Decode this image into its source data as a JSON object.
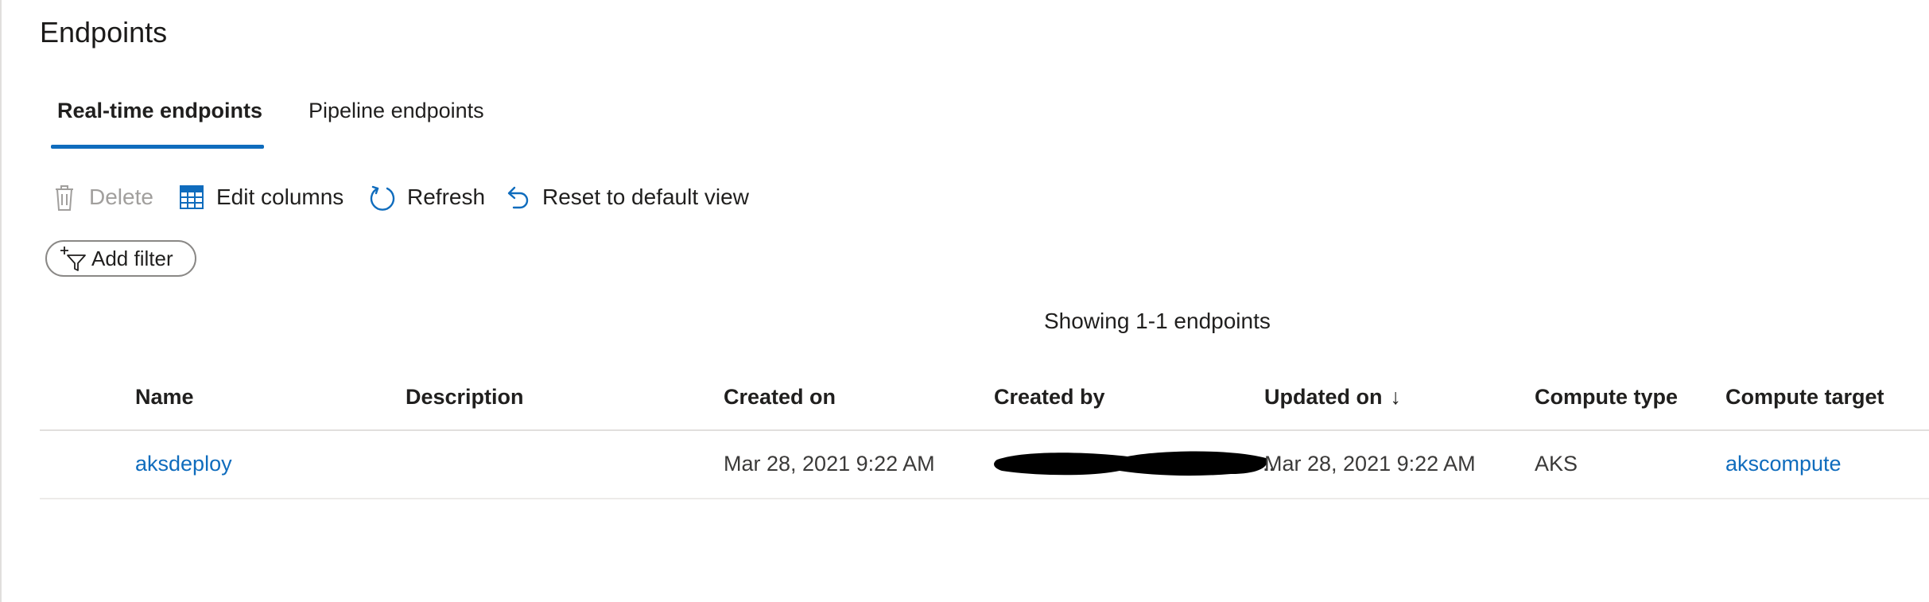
{
  "page": {
    "title": "Endpoints"
  },
  "tabs": [
    {
      "label": "Real-time endpoints",
      "active": true
    },
    {
      "label": "Pipeline endpoints",
      "active": false
    }
  ],
  "toolbar": {
    "delete_label": "Delete",
    "edit_columns_label": "Edit columns",
    "refresh_label": "Refresh",
    "reset_label": "Reset to default view"
  },
  "filter": {
    "add_filter_label": "Add filter"
  },
  "results": {
    "showing_text": "Showing 1-1 endpoints"
  },
  "table": {
    "columns": [
      {
        "label": "Name"
      },
      {
        "label": "Description"
      },
      {
        "label": "Created on"
      },
      {
        "label": "Created by"
      },
      {
        "label": "Updated on",
        "sort": "descending"
      },
      {
        "label": "Compute type"
      },
      {
        "label": "Compute target"
      }
    ],
    "rows": [
      {
        "name": "aksdeploy",
        "description": "",
        "created_on": "Mar 28, 2021 9:22 AM",
        "created_by": "[redacted]",
        "created_by_suffix": "..",
        "updated_on": "Mar 28, 2021 9:22 AM",
        "compute_type": "AKS",
        "compute_target": "akscompute"
      }
    ]
  },
  "colors": {
    "accent": "#0f6cbd",
    "text": "#201f1e",
    "muted": "#a19f9d",
    "divider": "#e1dfdd"
  },
  "icons": {
    "delete": "trash-icon",
    "edit_columns": "table-grid-icon",
    "refresh": "refresh-icon",
    "reset": "undo-icon",
    "add_filter": "add-filter-icon",
    "sort": "arrow-down-icon"
  }
}
